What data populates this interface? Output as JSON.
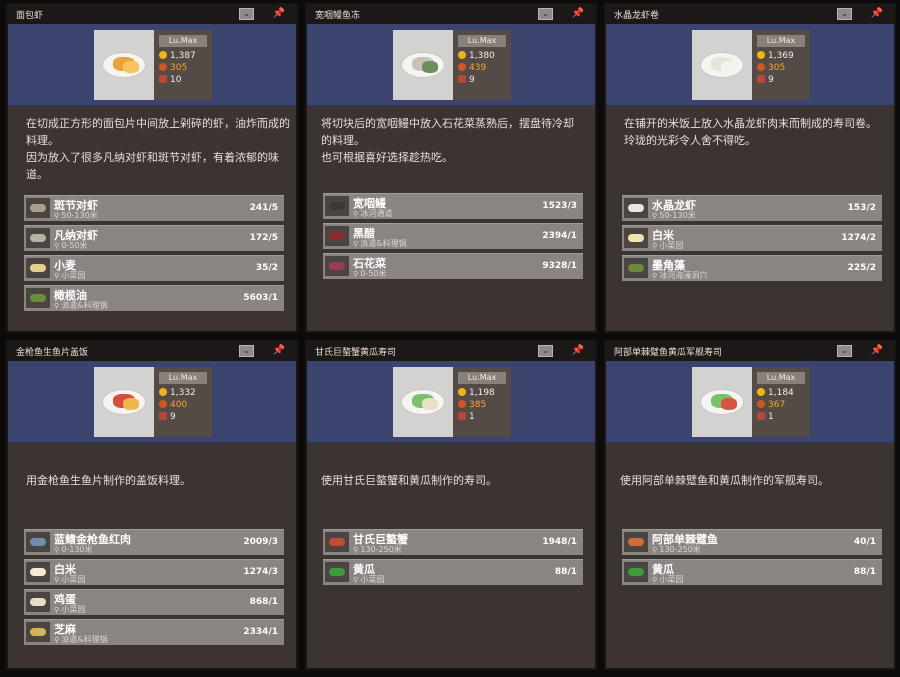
{
  "icons": {
    "dropdown": "chevron-down-icon",
    "pin": "pin-icon",
    "coin": "coin-icon",
    "taste": "taste-icon",
    "meat": "meat-icon",
    "location": "location-pin-icon"
  },
  "colors": {
    "header": "#3a446e",
    "panel": "#3b3431",
    "row": "#8a8582",
    "coin": "#f0b41a",
    "taste": "#f0a632",
    "pin": "#e28a2c"
  },
  "cards": [
    {
      "title": "面包虾",
      "level": "Lu.Max",
      "price": "1,387",
      "taste": "305",
      "portions": "10",
      "description": "在切成正方形的面包片中间放上剁碎的虾，油炸而成的料理。\n因为放入了很多凡纳对虾和斑节对虾，有着浓郁的味道。",
      "ingredients": [
        {
          "name": "斑节对虾",
          "source": "50-130米",
          "count": "241/5"
        },
        {
          "name": "凡纳对虾",
          "source": "0-50米",
          "count": "172/5"
        },
        {
          "name": "小麦",
          "source": "小菜园",
          "count": "35/2"
        },
        {
          "name": "橄榄油",
          "source": "派遣&料理锅",
          "count": "5603/1"
        }
      ]
    },
    {
      "title": "宽咽鳗鱼冻",
      "level": "Lu.Max",
      "price": "1,380",
      "taste": "439",
      "portions": "9",
      "description": "将切块后的宽咽鳗中放入石花菜蒸熟后，摆盘待冷却的料理。\n也可根据喜好选择趁热吃。",
      "ingredients": [
        {
          "name": "宽咽鳗",
          "source": "冰河通道",
          "count": "1523/3"
        },
        {
          "name": "黑醋",
          "source": "派遣&料理锅",
          "count": "2394/1"
        },
        {
          "name": "石花菜",
          "source": "0-50米",
          "count": "9328/1"
        }
      ]
    },
    {
      "title": "水晶龙虾卷",
      "level": "Lu.Max",
      "price": "1,369",
      "taste": "305",
      "portions": "9",
      "description": "在铺开的米饭上放入水晶龙虾肉末而制成的寿司卷。\n玲珑的光彩令人舍不得吃。",
      "ingredients": [
        {
          "name": "水晶龙虾",
          "source": "50-130米",
          "count": "153/2"
        },
        {
          "name": "白米",
          "source": "小菜园",
          "count": "1274/2"
        },
        {
          "name": "墨角藻",
          "source": "冰河海藻洞穴",
          "count": "225/2"
        }
      ]
    },
    {
      "title": "金枪鱼生鱼片盖饭",
      "level": "Lu.Max",
      "price": "1,332",
      "taste": "400",
      "portions": "9",
      "description": "用金枪鱼生鱼片制作的盖饭料理。",
      "ingredients": [
        {
          "name": "蓝鳍金枪鱼红肉",
          "source": "0-130米",
          "count": "2009/3"
        },
        {
          "name": "白米",
          "source": "小菜园",
          "count": "1274/3"
        },
        {
          "name": "鸡蛋",
          "source": "小菜园",
          "count": "868/1"
        },
        {
          "name": "芝麻",
          "source": "派遣&料理锅",
          "count": "2334/1"
        }
      ]
    },
    {
      "title": "甘氏巨螯蟹黄瓜寿司",
      "level": "Lu.Max",
      "price": "1,198",
      "taste": "385",
      "portions": "1",
      "description": "使用甘氏巨螯蟹和黄瓜制作的寿司。",
      "ingredients": [
        {
          "name": "甘氏巨螯蟹",
          "source": "130-250米",
          "count": "1948/1"
        },
        {
          "name": "黄瓜",
          "source": "小菜园",
          "count": "88/1"
        }
      ]
    },
    {
      "title": "阿部单棘躄鱼黄瓜军舰寿司",
      "level": "Lu.Max",
      "price": "1,184",
      "taste": "367",
      "portions": "1",
      "description": "使用阿部单棘躄鱼和黄瓜制作的军舰寿司。",
      "ingredients": [
        {
          "name": "阿部单棘躄鱼",
          "source": "130-250米",
          "count": "40/1"
        },
        {
          "name": "黄瓜",
          "source": "小菜园",
          "count": "88/1"
        }
      ]
    }
  ]
}
